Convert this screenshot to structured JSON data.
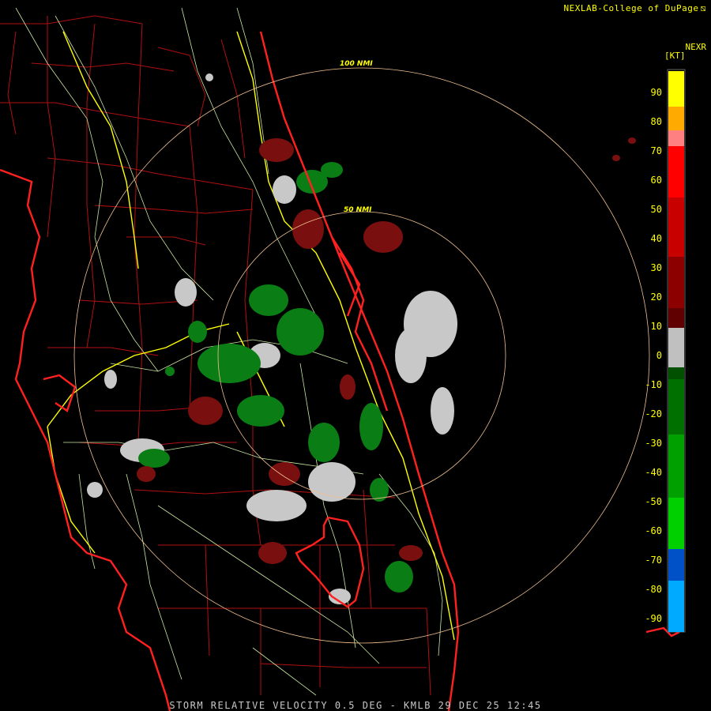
{
  "header": {
    "credit": "NEXLAB-College of DuPage",
    "product": "NEXR",
    "unit": "[KT]"
  },
  "footer": {
    "caption": "STORM RELATIVE VELOCITY 0.5 DEG - KMLB 29 DEC 25 12:45"
  },
  "range_rings": [
    {
      "label": "100 NMI"
    },
    {
      "label": "50 NMI"
    }
  ],
  "legend": {
    "ticks": [
      "90",
      "80",
      "70",
      "60",
      "50",
      "40",
      "30",
      "20",
      "10",
      "0",
      "-10",
      "-20",
      "-30",
      "-40",
      "-50",
      "-60",
      "-70",
      "-80",
      "-90"
    ],
    "colors": {
      "high_positive": "#ffff00",
      "positive": "#ff0000",
      "near_zero": "#c0c0c0",
      "negative": "#008000",
      "low_negative": "#00aaff"
    }
  },
  "map_colors": {
    "coastline": "#ff2020",
    "county_lines": "#b01010",
    "roads": "#c8e6a0",
    "interstates": "#ffff00",
    "range_rings": "#f0c090"
  }
}
